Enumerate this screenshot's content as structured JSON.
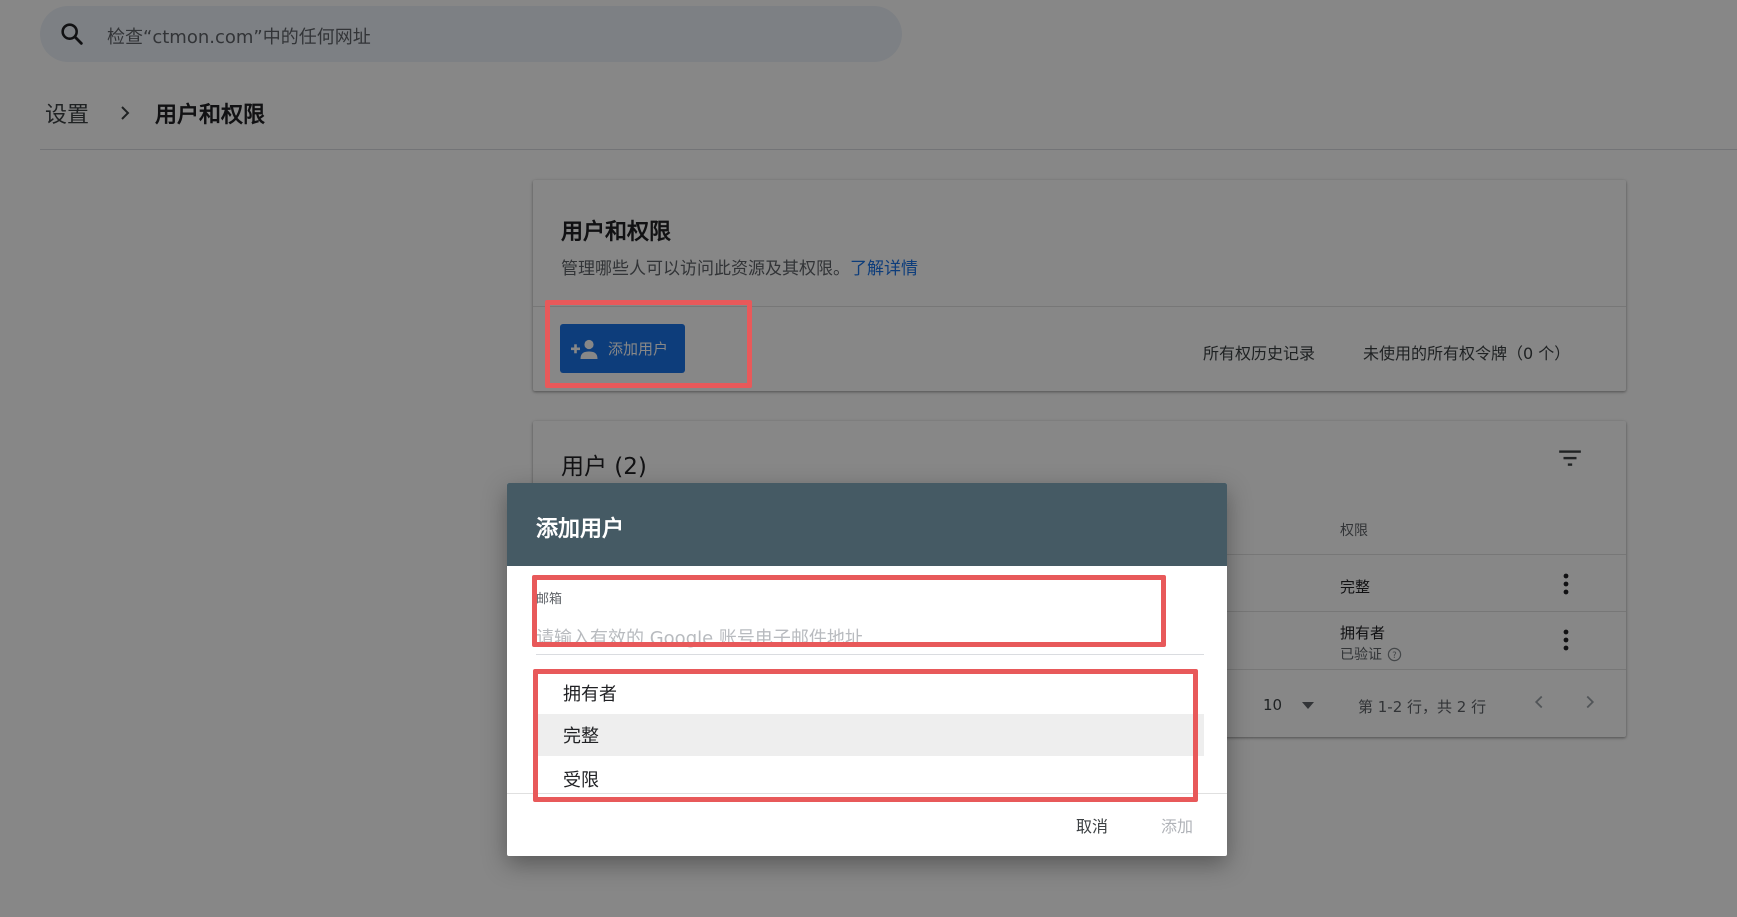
{
  "search": {
    "placeholder": "检查“ctmon.com”中的任何网址"
  },
  "breadcrumb": {
    "root": "设置",
    "current": "用户和权限"
  },
  "permissions_card": {
    "title": "用户和权限",
    "description": "管理哪些人可以访问此资源及其权限。",
    "learn_more": "了解详情",
    "add_user_label": "添加用户",
    "ownership_history": "所有权历史记录",
    "unused_tokens": "未使用的所有权令牌（0 个）"
  },
  "users_card": {
    "title": "用户 (2)",
    "column_permission": "权限",
    "rows": [
      {
        "permission": "完整",
        "sub": ""
      },
      {
        "permission": "拥有者",
        "sub": "已验证"
      }
    ],
    "pager": {
      "page_size": "10",
      "range": "第 1-2 行，共 2 行"
    }
  },
  "dialog": {
    "title": "添加用户",
    "email_label": "邮箱",
    "email_placeholder": "请输入有效的 Google 账号电子邮件地址",
    "options": [
      "拥有者",
      "完整",
      "受限"
    ],
    "hovered_option": "完整",
    "cancel_label": "取消",
    "add_label": "添加"
  },
  "colors": {
    "accent": "#1a73e8",
    "dialog_header": "#455a64",
    "highlight": "#e8595a"
  },
  "icons": {
    "search": "search-icon",
    "breadcrumb_separator": "chevron-right-icon",
    "add_user": "person-add-icon",
    "filter": "filter-icon",
    "more": "more-vert-icon",
    "help": "help-circle-icon"
  }
}
